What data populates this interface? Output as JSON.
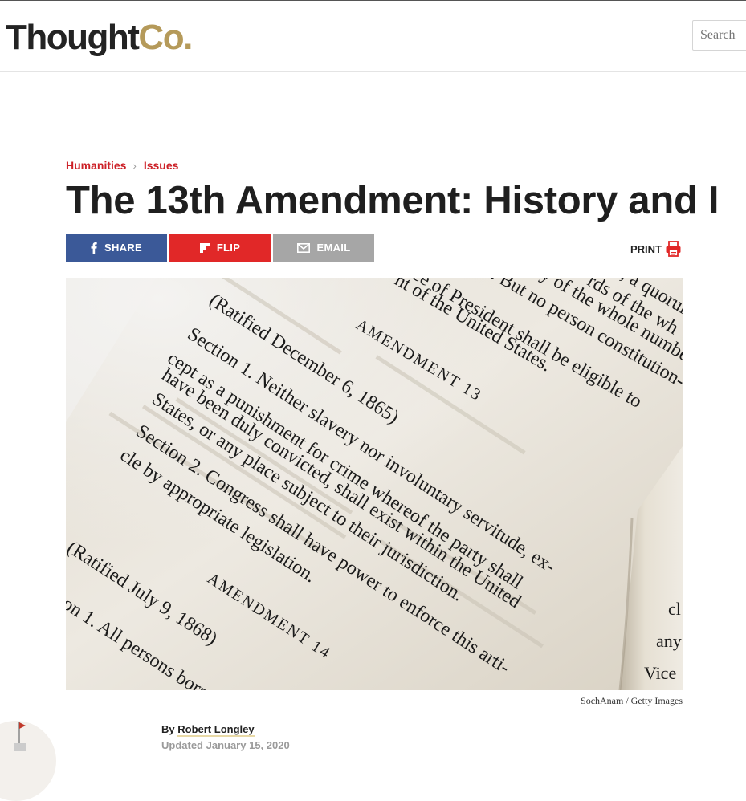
{
  "header": {
    "logo_main": "Thought",
    "logo_accent": "Co.",
    "search_placeholder": "Search"
  },
  "breadcrumb": {
    "items": [
      "Humanities",
      "Issues"
    ],
    "separator": "›"
  },
  "article": {
    "title": "The 13th Amendment: History and I",
    "image_credit": "SochAnam / Getty Images",
    "byline_prefix": "By",
    "author": "Robert Longley",
    "updated": "Updated January 15, 2020"
  },
  "share": {
    "share_label": "SHARE",
    "flip_label": "FLIP",
    "email_label": "EMAIL",
    "print_label": "PRINT"
  },
  "photo_text": [
    "nt of the United States.",
    "AMENDMENT 13",
    "(Ratified December 6, 1865)",
    "Section 1. Neither slavery nor involuntary servitude, ex-",
    "cept as a punishment for crime whereof the party shall",
    "have been duly convicted, shall exist within the United",
    "States, or any place subject to their jurisdiction.",
    "Section 2. Congress shall have power to enforce this arti-",
    "cle by appropriate legislation.",
    "AMENDMENT 14",
    "(Ratified July 9, 1868)",
    "on 1. All persons born",
    "ce of President shall be eligible to",
    ". But no person constitution-",
    "y of the whole numbe",
    "rds of the wh",
    ", a quorur"
  ],
  "icons": {
    "facebook": "facebook-icon",
    "flipboard": "flipboard-icon",
    "email": "envelope-icon",
    "print": "printer-icon"
  },
  "colors": {
    "brand_gold": "#b59a5a",
    "breadcrumb_red": "#cc1f26",
    "facebook_blue": "#3b5998",
    "flip_red": "#e12828",
    "email_gray": "#a6a6a6"
  }
}
